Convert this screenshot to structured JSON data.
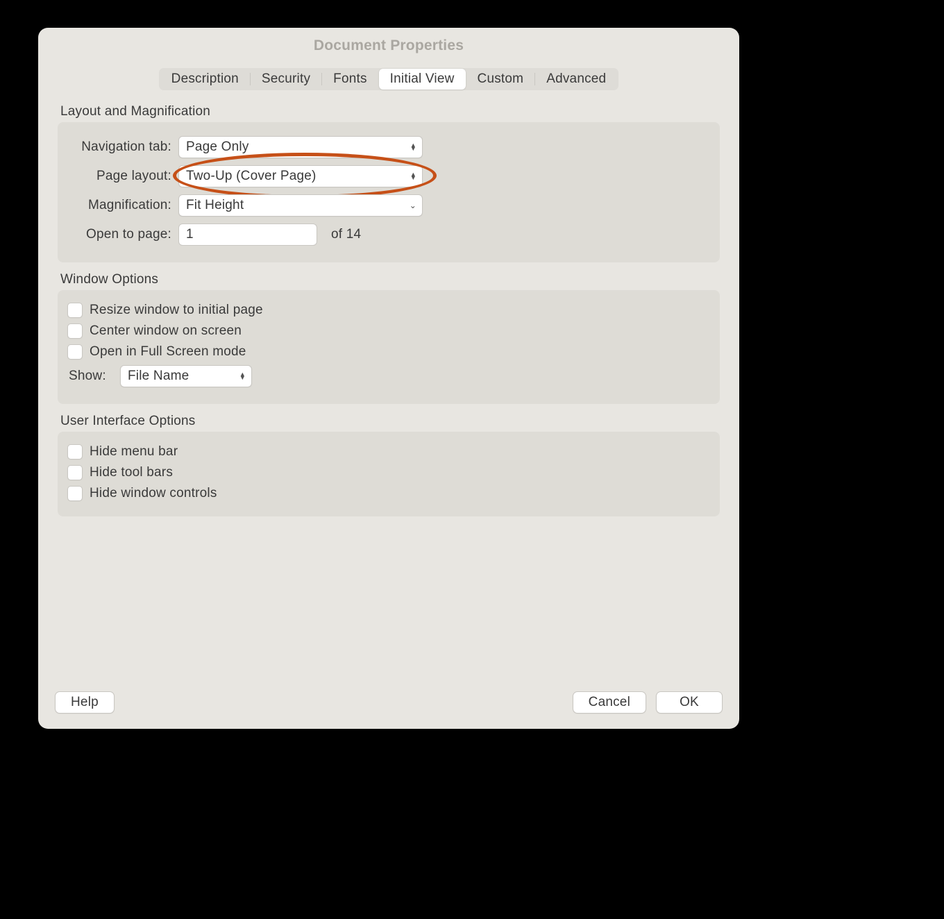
{
  "title": "Document Properties",
  "tabs": {
    "description": "Description",
    "security": "Security",
    "fonts": "Fonts",
    "initial_view": "Initial View",
    "custom": "Custom",
    "advanced": "Advanced"
  },
  "layout_mag": {
    "heading": "Layout and Magnification",
    "nav_label": "Navigation tab:",
    "nav_value": "Page Only",
    "pagelayout_label": "Page layout:",
    "pagelayout_value": "Two-Up (Cover Page)",
    "mag_label": "Magnification:",
    "mag_value": "Fit Height",
    "open_label": "Open to page:",
    "open_value": "1",
    "of_text": "of 14"
  },
  "window_opts": {
    "heading": "Window Options",
    "resize": "Resize window to initial page",
    "center": "Center window on screen",
    "fullscreen": "Open in Full Screen mode",
    "show_label": "Show:",
    "show_value": "File Name"
  },
  "ui_opts": {
    "heading": "User Interface Options",
    "hide_menu": "Hide menu bar",
    "hide_tool": "Hide tool bars",
    "hide_window": "Hide window controls"
  },
  "footer": {
    "help": "Help",
    "cancel": "Cancel",
    "ok": "OK"
  }
}
